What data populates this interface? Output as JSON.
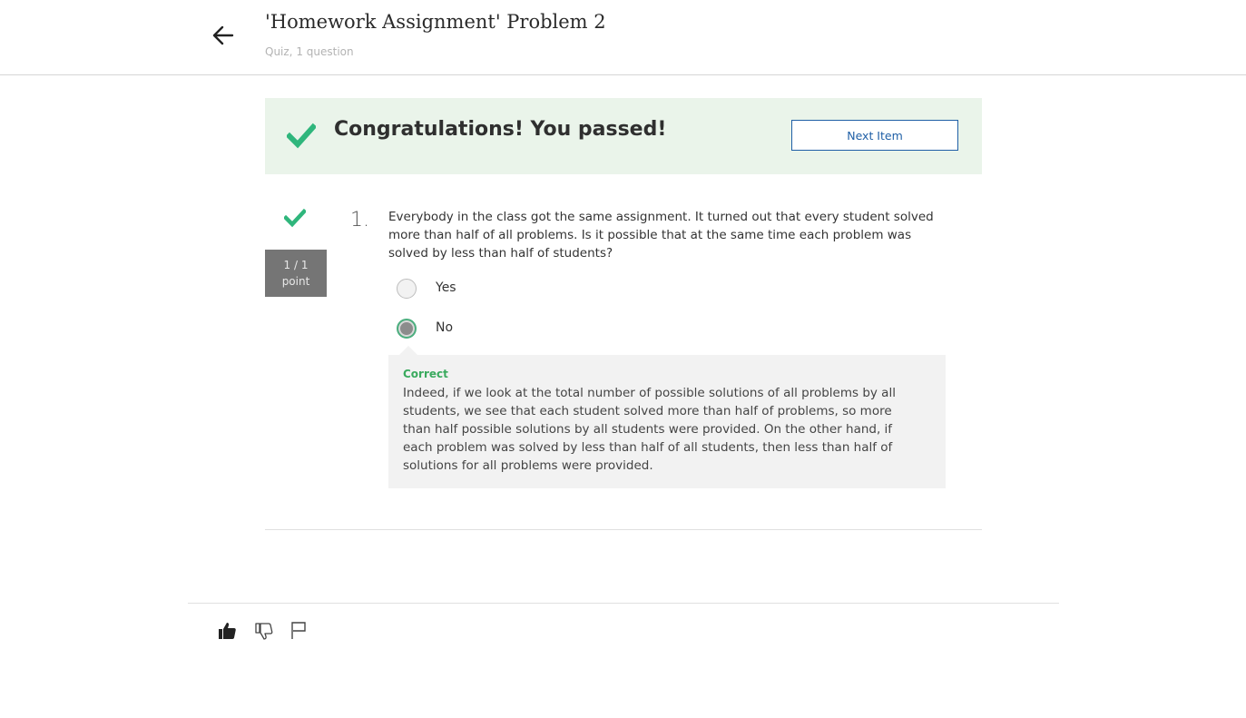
{
  "header": {
    "title": "'Homework Assignment' Problem 2",
    "subtitle": "Quiz, 1 question"
  },
  "banner": {
    "message": "Congratulations! You passed!",
    "next_button_label": "Next Item"
  },
  "question": {
    "number": "1.",
    "score": "1 / 1",
    "score_unit": "point",
    "text": "Everybody in the class got the same assignment. It turned out that every student solved more than half of all problems. Is it possible that at the same time each problem was solved by less than half of students?",
    "options": [
      {
        "label": "Yes",
        "selected": false
      },
      {
        "label": "No",
        "selected": true
      }
    ],
    "feedback": {
      "status": "Correct",
      "text": "Indeed, if we look at the total number of possible solutions of all problems by all students, we see that each student solved more than half of problems, so more than half possible solutions by all students were provided. On the other hand, if each problem was solved by less than half of all students, then less than half of solutions for all problems were provided."
    }
  },
  "colors": {
    "success_green": "#2fb67c",
    "banner_bg": "#eaf4ea",
    "link_blue": "#1f5fa6",
    "points_bg": "#757575"
  },
  "icons": {
    "back": "arrow-left-icon",
    "pass": "checkmark-icon",
    "like": "thumbs-up-icon",
    "dislike": "thumbs-down-icon",
    "flag": "flag-icon"
  }
}
